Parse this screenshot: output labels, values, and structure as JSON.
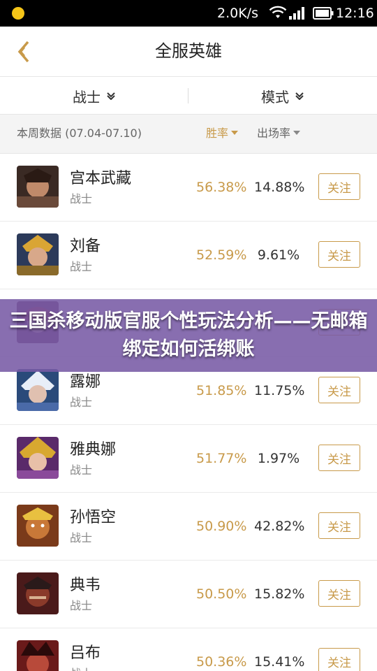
{
  "status_bar": {
    "net_speed": "2.0K/s",
    "time": "12:16",
    "icons": [
      "notification-dot-icon",
      "wifi-icon",
      "signal-icon",
      "battery-icon"
    ]
  },
  "header": {
    "title": "全服英雄",
    "back_icon": "chevron-left-icon"
  },
  "filters": {
    "role": "战士",
    "mode": "模式"
  },
  "stats_header": {
    "week_label": "本周数据 (07.04-07.10)",
    "sort_win_rate": "胜率",
    "sort_appearance": "出场率"
  },
  "colors": {
    "accent": "#c89a4a",
    "overlay": "#785aa5"
  },
  "heroes": [
    {
      "name": "宫本武藏",
      "role": "战士",
      "win_rate": "56.38%",
      "appear_rate": "14.88%",
      "follow_label": "关注"
    },
    {
      "name": "刘备",
      "role": "战士",
      "win_rate": "52.59%",
      "appear_rate": "9.61%",
      "follow_label": "关注"
    },
    {
      "name": "",
      "role": "",
      "win_rate": "",
      "appear_rate": "",
      "follow_label": "关注"
    },
    {
      "name": "露娜",
      "role": "战士",
      "win_rate": "51.85%",
      "appear_rate": "11.75%",
      "follow_label": "关注"
    },
    {
      "name": "雅典娜",
      "role": "战士",
      "win_rate": "51.77%",
      "appear_rate": "1.97%",
      "follow_label": "关注"
    },
    {
      "name": "孙悟空",
      "role": "战士",
      "win_rate": "50.90%",
      "appear_rate": "42.82%",
      "follow_label": "关注"
    },
    {
      "name": "典韦",
      "role": "战士",
      "win_rate": "50.50%",
      "appear_rate": "15.82%",
      "follow_label": "关注"
    },
    {
      "name": "吕布",
      "role": "战士",
      "win_rate": "50.36%",
      "appear_rate": "15.41%",
      "follow_label": "关注"
    }
  ],
  "overlay": {
    "text": "三国杀移动版官服个性玩法分析——无邮箱绑定如何活绑账"
  }
}
